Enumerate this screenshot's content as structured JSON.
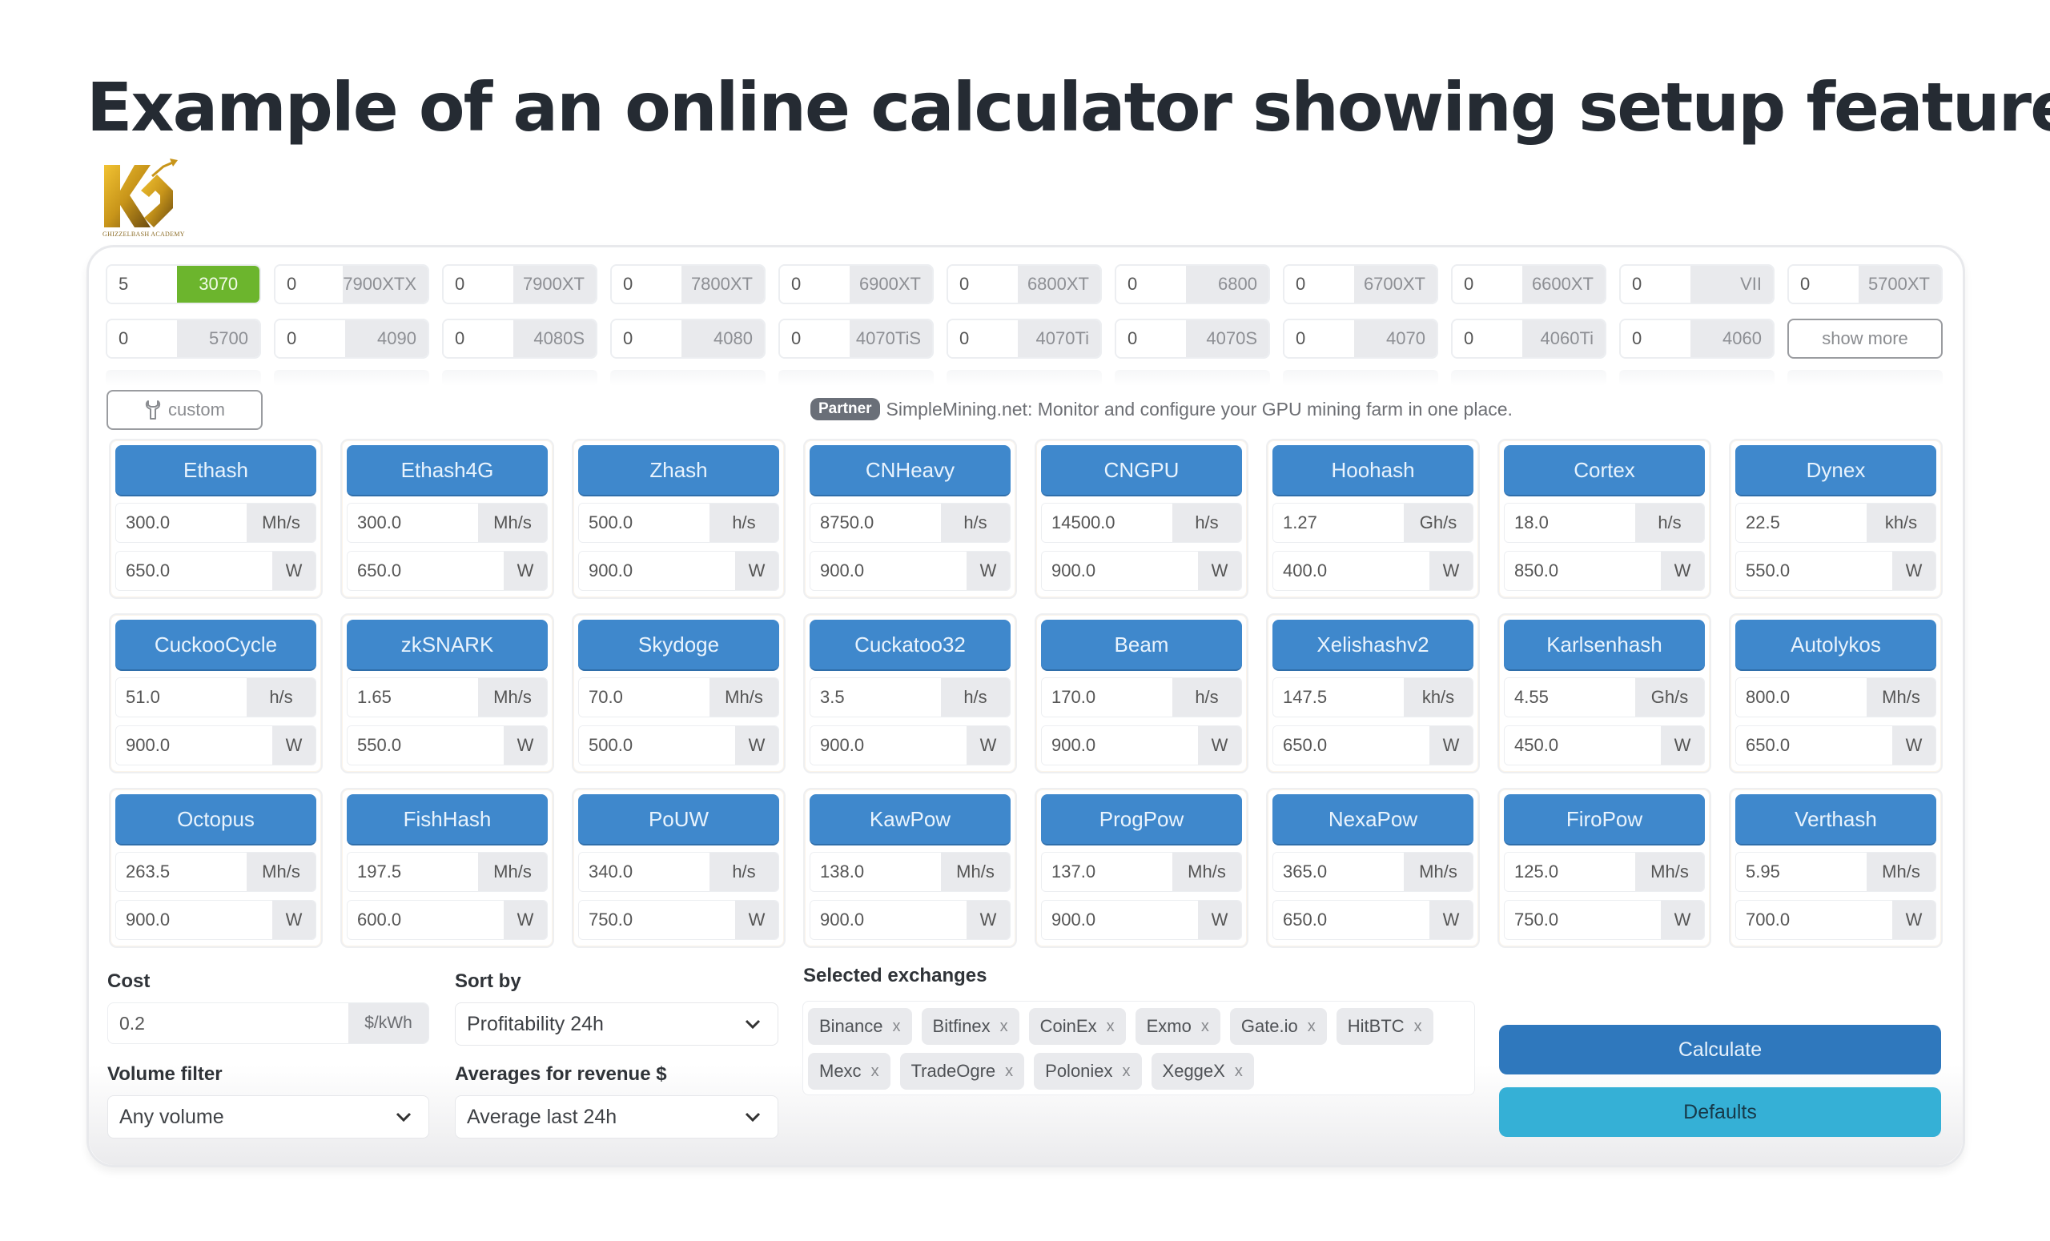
{
  "page_title": "Example of an online calculator showing setup features",
  "logo": {
    "icon": "kg-logo-icon",
    "caption": "GHIZZELBASH ACADEMY"
  },
  "gpus": [
    {
      "qty": "5",
      "name": "3070",
      "active": true
    },
    {
      "qty": "0",
      "name": "7900XTX"
    },
    {
      "qty": "0",
      "name": "7900XT"
    },
    {
      "qty": "0",
      "name": "7800XT"
    },
    {
      "qty": "0",
      "name": "6900XT"
    },
    {
      "qty": "0",
      "name": "6800XT"
    },
    {
      "qty": "0",
      "name": "6800"
    },
    {
      "qty": "0",
      "name": "6700XT"
    },
    {
      "qty": "0",
      "name": "6600XT"
    },
    {
      "qty": "0",
      "name": "VII"
    },
    {
      "qty": "0",
      "name": "5700XT"
    },
    {
      "qty": "0",
      "name": "5700"
    },
    {
      "qty": "0",
      "name": "4090"
    },
    {
      "qty": "0",
      "name": "4080S"
    },
    {
      "qty": "0",
      "name": "4080"
    },
    {
      "qty": "0",
      "name": "4070TiS"
    },
    {
      "qty": "0",
      "name": "4070Ti"
    },
    {
      "qty": "0",
      "name": "4070S"
    },
    {
      "qty": "0",
      "name": "4070"
    },
    {
      "qty": "0",
      "name": "4060Ti"
    },
    {
      "qty": "0",
      "name": "4060"
    }
  ],
  "show_more_label": "show more",
  "custom_button": {
    "label": "custom",
    "icon": "wrench-icon"
  },
  "partner": {
    "badge": "Partner",
    "text": "SimpleMining.net: Monitor and configure your GPU mining farm in one place."
  },
  "algorithms": [
    {
      "name": "Ethash",
      "hashrate": "300.0",
      "hr_unit": "Mh/s",
      "power": "650.0",
      "pw_unit": "W"
    },
    {
      "name": "Ethash4G",
      "hashrate": "300.0",
      "hr_unit": "Mh/s",
      "power": "650.0",
      "pw_unit": "W"
    },
    {
      "name": "Zhash",
      "hashrate": "500.0",
      "hr_unit": "h/s",
      "power": "900.0",
      "pw_unit": "W"
    },
    {
      "name": "CNHeavy",
      "hashrate": "8750.0",
      "hr_unit": "h/s",
      "power": "900.0",
      "pw_unit": "W"
    },
    {
      "name": "CNGPU",
      "hashrate": "14500.0",
      "hr_unit": "h/s",
      "power": "900.0",
      "pw_unit": "W"
    },
    {
      "name": "Hoohash",
      "hashrate": "1.27",
      "hr_unit": "Gh/s",
      "power": "400.0",
      "pw_unit": "W"
    },
    {
      "name": "Cortex",
      "hashrate": "18.0",
      "hr_unit": "h/s",
      "power": "850.0",
      "pw_unit": "W"
    },
    {
      "name": "Dynex",
      "hashrate": "22.5",
      "hr_unit": "kh/s",
      "power": "550.0",
      "pw_unit": "W"
    },
    {
      "name": "CuckooCycle",
      "hashrate": "51.0",
      "hr_unit": "h/s",
      "power": "900.0",
      "pw_unit": "W"
    },
    {
      "name": "zkSNARK",
      "hashrate": "1.65",
      "hr_unit": "Mh/s",
      "power": "550.0",
      "pw_unit": "W"
    },
    {
      "name": "Skydoge",
      "hashrate": "70.0",
      "hr_unit": "Mh/s",
      "power": "500.0",
      "pw_unit": "W"
    },
    {
      "name": "Cuckatoo32",
      "hashrate": "3.5",
      "hr_unit": "h/s",
      "power": "900.0",
      "pw_unit": "W"
    },
    {
      "name": "Beam",
      "hashrate": "170.0",
      "hr_unit": "h/s",
      "power": "900.0",
      "pw_unit": "W"
    },
    {
      "name": "Xelishashv2",
      "hashrate": "147.5",
      "hr_unit": "kh/s",
      "power": "650.0",
      "pw_unit": "W"
    },
    {
      "name": "Karlsenhash",
      "hashrate": "4.55",
      "hr_unit": "Gh/s",
      "power": "450.0",
      "pw_unit": "W"
    },
    {
      "name": "Autolykos",
      "hashrate": "800.0",
      "hr_unit": "Mh/s",
      "power": "650.0",
      "pw_unit": "W"
    },
    {
      "name": "Octopus",
      "hashrate": "263.5",
      "hr_unit": "Mh/s",
      "power": "900.0",
      "pw_unit": "W"
    },
    {
      "name": "FishHash",
      "hashrate": "197.5",
      "hr_unit": "Mh/s",
      "power": "600.0",
      "pw_unit": "W"
    },
    {
      "name": "PoUW",
      "hashrate": "340.0",
      "hr_unit": "h/s",
      "power": "750.0",
      "pw_unit": "W"
    },
    {
      "name": "KawPow",
      "hashrate": "138.0",
      "hr_unit": "Mh/s",
      "power": "900.0",
      "pw_unit": "W"
    },
    {
      "name": "ProgPow",
      "hashrate": "137.0",
      "hr_unit": "Mh/s",
      "power": "900.0",
      "pw_unit": "W"
    },
    {
      "name": "NexaPow",
      "hashrate": "365.0",
      "hr_unit": "Mh/s",
      "power": "650.0",
      "pw_unit": "W"
    },
    {
      "name": "FiroPow",
      "hashrate": "125.0",
      "hr_unit": "Mh/s",
      "power": "750.0",
      "pw_unit": "W"
    },
    {
      "name": "Verthash",
      "hashrate": "5.95",
      "hr_unit": "Mh/s",
      "power": "700.0",
      "pw_unit": "W"
    }
  ],
  "cost": {
    "label": "Cost",
    "value": "0.2",
    "unit": "$/kWh"
  },
  "sort_by": {
    "label": "Sort by",
    "selected": "Profitability 24h"
  },
  "volume_filter": {
    "label": "Volume filter",
    "selected": "Any volume"
  },
  "averages": {
    "label": "Averages for revenue $",
    "selected": "Average last 24h"
  },
  "exchanges": {
    "label": "Selected exchanges",
    "remove_glyph": "x",
    "items": [
      "Binance",
      "Bitfinex",
      "CoinEx",
      "Exmo",
      "Gate.io",
      "HitBTC",
      "Mexc",
      "TradeOgre",
      "Poloniex",
      "XeggeX"
    ]
  },
  "buttons": {
    "calculate": "Calculate",
    "defaults": "Defaults"
  },
  "colors": {
    "accent_blue": "#3f88cc",
    "calculate_blue": "#2f78bd",
    "defaults_cyan": "#35b0d6",
    "active_gpu_green": "#6cb52d",
    "partner_badge": "#6a6f78"
  }
}
